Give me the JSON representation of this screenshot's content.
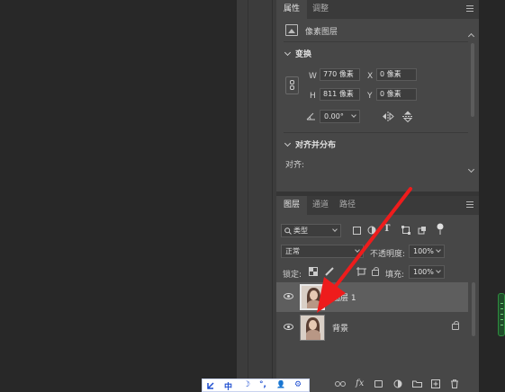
{
  "properties_panel": {
    "tabs": [
      "属性",
      "调整"
    ],
    "pixel_layer_label": "像素图层",
    "transform": {
      "title": "变换",
      "w_label": "W",
      "w_value": "770 像素",
      "h_label": "H",
      "h_value": "811 像素",
      "x_label": "X",
      "x_value": "0 像素",
      "y_label": "Y",
      "y_value": "0 像素",
      "angle_value": "0.00°"
    },
    "align": {
      "title": "对齐并分布",
      "align_label": "对齐:"
    }
  },
  "layers_panel": {
    "tabs": [
      "图层",
      "通道",
      "路径"
    ],
    "filter_kind": "类型",
    "blend_mode": "正常",
    "opacity_label": "不透明度:",
    "opacity_value": "100%",
    "lock_label": "锁定:",
    "fill_label": "填充:",
    "fill_value": "100%",
    "layers": [
      {
        "name": "图层 1",
        "selected": true,
        "locked": false
      },
      {
        "name": "背景",
        "selected": false,
        "locked": true
      }
    ],
    "bottom_icons": [
      "link-icon",
      "fx-icon",
      "mask-icon",
      "adjustment-icon",
      "folder-icon",
      "new-layer-icon",
      "trash-icon"
    ],
    "fx_label": "fx"
  },
  "ime_toolbar": {
    "items": [
      "中",
      "☽",
      "°,",
      "👤",
      "⚙"
    ]
  },
  "colors": {
    "panel_bg": "#474747",
    "canvas_bg": "#282828",
    "annotation_arrow": "#ee1c1c",
    "selected_row": "#5e5e5e"
  }
}
